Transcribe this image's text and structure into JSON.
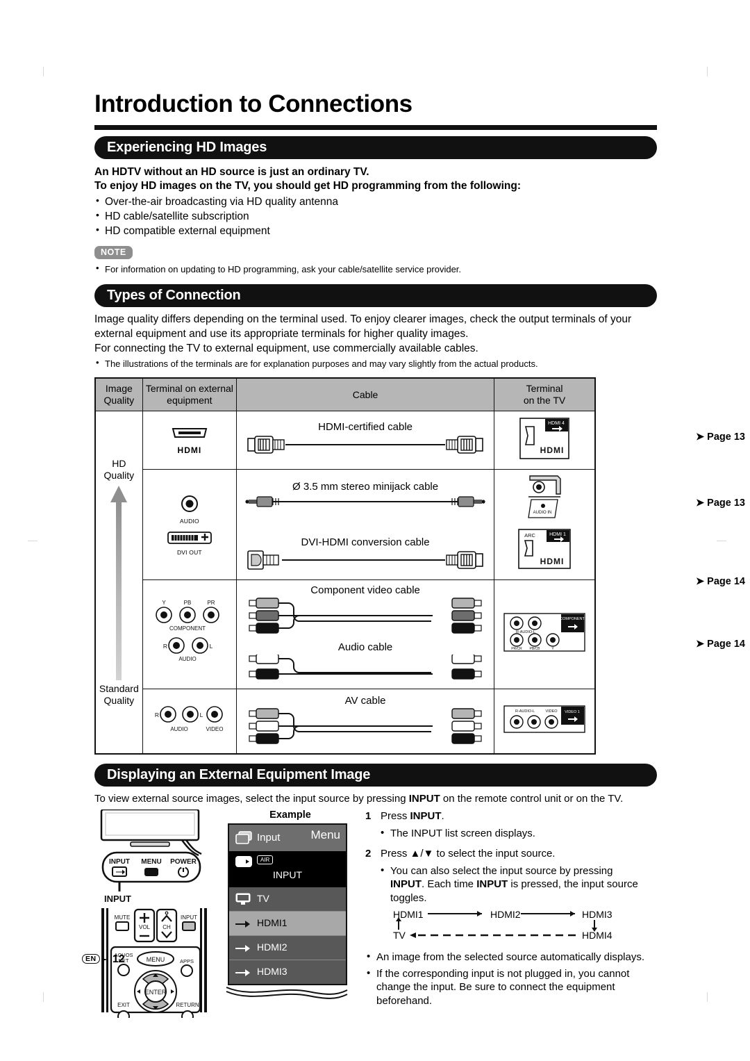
{
  "page": {
    "title": "Introduction to Connections",
    "footer_lang": "EN",
    "footer_sep": "-",
    "footer_number": "12"
  },
  "section_hd": {
    "heading": "Experiencing HD Images",
    "lead_line1": "An HDTV without an HD source is just an ordinary TV.",
    "lead_line2": "To enjoy HD images on the TV, you should get HD programming from the following:",
    "bullets": [
      "Over-the-air broadcasting via HD quality antenna",
      "HD cable/satellite subscription",
      "HD compatible external equipment"
    ],
    "note_badge": "NOTE",
    "note_text": "For information on updating to HD programming, ask your cable/satellite service provider."
  },
  "section_types": {
    "heading": "Types of Connection",
    "para1": "Image quality differs depending on the terminal used. To enjoy clearer images, check the output terminals of your external equipment and use its appropriate terminals for higher quality images.",
    "para2": "For connecting the TV to external equipment, use commercially available cables.",
    "bullet": "The illustrations of the terminals are for explanation purposes and may vary slightly from the actual products.",
    "table": {
      "headers": {
        "quality_l1": "Image",
        "quality_l2": "Quality",
        "external_l1": "Terminal on external",
        "external_l2": "equipment",
        "cable": "Cable",
        "tv_l1": "Terminal",
        "tv_l2": "on the TV"
      },
      "quality_top": "HD Quality",
      "quality_top_l1": "HD",
      "quality_top_l2": "Quality",
      "quality_bottom_l1": "Standard",
      "quality_bottom_l2": "Quality",
      "rows": [
        {
          "external_labels": [
            "HDMI"
          ],
          "cables": [
            "HDMI-certified cable"
          ],
          "tv_labels": [
            "HDMI 4",
            "HDMI"
          ],
          "page_ref": "Page 13"
        },
        {
          "external_labels": [
            "AUDIO",
            "DVI OUT"
          ],
          "cables": [
            "Ø 3.5 mm stereo minijack cable",
            "DVI-HDMI conversion cable"
          ],
          "tv_labels": [
            "AUDIO IN",
            "ARC",
            "HDMI 1",
            "HDMI"
          ],
          "page_ref": "Page 13"
        },
        {
          "external_labels": [
            "Y",
            "PB",
            "PR",
            "COMPONENT",
            "R",
            "L",
            "AUDIO"
          ],
          "cables": [
            "Component video cable",
            "Audio cable"
          ],
          "tv_labels": [
            "R-AUDIO-L",
            "COMPONENT",
            "PR/CR",
            "PB/CB",
            "Y"
          ],
          "page_ref": "Page 14"
        },
        {
          "external_labels": [
            "R",
            "L",
            "AUDIO",
            "VIDEO"
          ],
          "cables": [
            "AV cable"
          ],
          "tv_labels": [
            "R-AUDIO-L",
            "VIDEO",
            "VIDEO 1"
          ],
          "page_ref": "Page 14"
        }
      ]
    }
  },
  "section_display": {
    "heading": "Displaying an External Equipment Image",
    "lead_prefix": "To view external source images, select the input source by pressing ",
    "lead_bold": "INPUT",
    "lead_suffix": " on the remote control unit or on the TV.",
    "tv_panel": {
      "buttons": [
        "INPUT",
        "MENU",
        "POWER"
      ],
      "callout": "INPUT"
    },
    "remote": {
      "mute": "MUTE",
      "vol": "VOL",
      "ch": "CH",
      "input": "INPUT",
      "aquos_l1": "AQUOS",
      "aquos_l2": "NET",
      "menu": "MENU",
      "apps": "APPS",
      "enter": "ENTER",
      "exit": "EXIT",
      "return": "RETURN"
    },
    "example": {
      "caption": "Example",
      "header_label": "Input",
      "header_menu": "Menu",
      "air_badge": "AIR",
      "input_title": "INPUT",
      "items": [
        {
          "label": "TV",
          "selected": false
        },
        {
          "label": "HDMI1",
          "selected": true
        },
        {
          "label": "HDMI2",
          "selected": false
        },
        {
          "label": "HDMI3",
          "selected": false
        }
      ]
    },
    "steps": [
      {
        "num": "1",
        "text_prefix": "Press ",
        "text_bold": "INPUT",
        "text_suffix": ".",
        "sub": "The INPUT list screen displays."
      },
      {
        "num": "2",
        "text": "Press ▲/▼ to select the input source.",
        "sub_a": "You can also select the input source by pressing",
        "sub_b_bold1": "INPUT",
        "sub_b_mid": ". Each time ",
        "sub_b_bold2": "INPUT",
        "sub_b_end": " is pressed, the input source toggles."
      }
    ],
    "toggle_diagram": {
      "nodes": [
        "HDMI1",
        "HDMI2",
        "HDMI3",
        "HDMI4",
        "TV"
      ]
    },
    "final_bullets": [
      "An image from the selected source automatically displays.",
      "If the corresponding input is not plugged in, you cannot change the input. Be sure to connect the equipment beforehand."
    ]
  },
  "colors": {
    "band": "#111111",
    "table_header": "#b6b6b6",
    "note_badge": "#8e8e8e",
    "osd_selected": "#a8a8a8"
  }
}
